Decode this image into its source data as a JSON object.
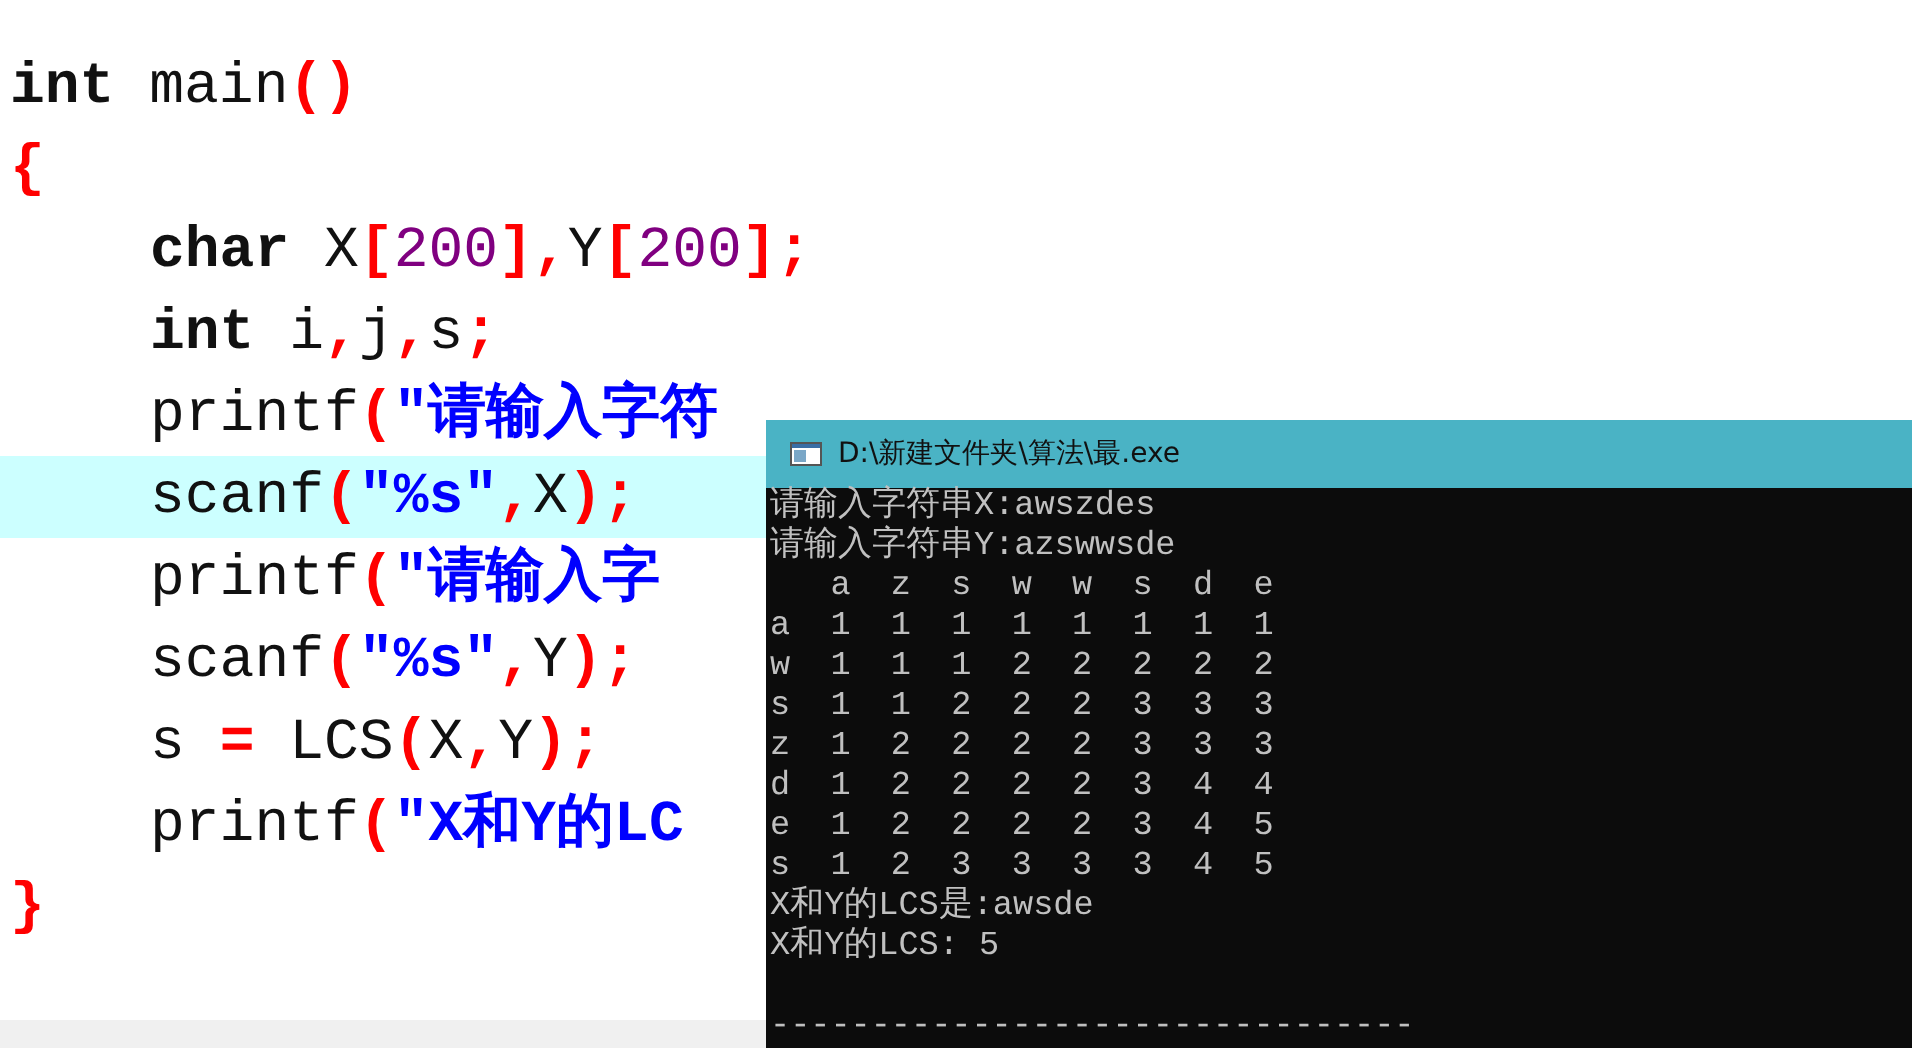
{
  "editor": {
    "lines": [
      {
        "highlighted": false,
        "tokens": [
          {
            "kind": "keyword",
            "text": "int"
          },
          {
            "kind": "plain",
            "text": " main"
          },
          {
            "kind": "punct",
            "text": "()"
          }
        ]
      },
      {
        "highlighted": false,
        "tokens": [
          {
            "kind": "punct",
            "text": "{"
          }
        ],
        "children": [
          {
            "highlighted": false,
            "tokens": [
              {
                "kind": "keyword",
                "text": "char"
              },
              {
                "kind": "plain",
                "text": " X"
              },
              {
                "kind": "punct",
                "text": "["
              },
              {
                "kind": "number",
                "text": "200"
              },
              {
                "kind": "punct",
                "text": "],"
              },
              {
                "kind": "plain",
                "text": "Y"
              },
              {
                "kind": "punct",
                "text": "["
              },
              {
                "kind": "number",
                "text": "200"
              },
              {
                "kind": "punct",
                "text": "];"
              }
            ]
          },
          {
            "highlighted": false,
            "tokens": [
              {
                "kind": "keyword",
                "text": "int"
              },
              {
                "kind": "plain",
                "text": " i"
              },
              {
                "kind": "punct",
                "text": ","
              },
              {
                "kind": "plain",
                "text": "j"
              },
              {
                "kind": "punct",
                "text": ","
              },
              {
                "kind": "plain",
                "text": "s"
              },
              {
                "kind": "punct",
                "text": ";"
              }
            ]
          },
          {
            "highlighted": false,
            "tokens": [
              {
                "kind": "plain",
                "text": "printf"
              },
              {
                "kind": "punct",
                "text": "("
              },
              {
                "kind": "string",
                "text": "\"请输入字符"
              }
            ]
          },
          {
            "highlighted": true,
            "tokens": [
              {
                "kind": "plain",
                "text": "scanf"
              },
              {
                "kind": "punct",
                "text": "("
              },
              {
                "kind": "string",
                "text": "\"%s\""
              },
              {
                "kind": "punct",
                "text": ","
              },
              {
                "kind": "plain",
                "text": "X"
              },
              {
                "kind": "punct",
                "text": ");"
              }
            ]
          },
          {
            "highlighted": false,
            "tokens": [
              {
                "kind": "plain",
                "text": "printf"
              },
              {
                "kind": "punct",
                "text": "("
              },
              {
                "kind": "string",
                "text": "\"请输入字"
              }
            ]
          },
          {
            "highlighted": false,
            "tokens": [
              {
                "kind": "plain",
                "text": "scanf"
              },
              {
                "kind": "punct",
                "text": "("
              },
              {
                "kind": "string",
                "text": "\"%s\""
              },
              {
                "kind": "punct",
                "text": ","
              },
              {
                "kind": "plain",
                "text": "Y"
              },
              {
                "kind": "punct",
                "text": ");"
              }
            ]
          },
          {
            "highlighted": false,
            "tokens": [
              {
                "kind": "plain",
                "text": "s "
              },
              {
                "kind": "punct",
                "text": "="
              },
              {
                "kind": "plain",
                "text": " LCS"
              },
              {
                "kind": "punct",
                "text": "("
              },
              {
                "kind": "plain",
                "text": "X"
              },
              {
                "kind": "punct",
                "text": ","
              },
              {
                "kind": "plain",
                "text": "Y"
              },
              {
                "kind": "punct",
                "text": ");"
              }
            ]
          },
          {
            "highlighted": false,
            "tokens": [
              {
                "kind": "plain",
                "text": "printf"
              },
              {
                "kind": "punct",
                "text": "("
              },
              {
                "kind": "string",
                "text": "\"X和Y的LC"
              }
            ]
          }
        ]
      },
      {
        "highlighted": false,
        "tokens": [
          {
            "kind": "punct",
            "text": "}"
          }
        ]
      }
    ]
  },
  "console": {
    "title": "D:\\新建文件夹\\算法\\最.exe",
    "lines": [
      {
        "kind": "output",
        "text": "请输入字符串X:awszdes"
      },
      {
        "kind": "output",
        "text": "请输入字符串Y:azswwsde"
      },
      {
        "kind": "output",
        "text": "   a  z  s  w  w  s  d  e"
      },
      {
        "kind": "output",
        "text": "a  1  1  1  1  1  1  1  1"
      },
      {
        "kind": "output",
        "text": "w  1  1  1  2  2  2  2  2"
      },
      {
        "kind": "output",
        "text": "s  1  1  2  2  2  3  3  3"
      },
      {
        "kind": "output",
        "text": "z  1  2  2  2  2  3  3  3"
      },
      {
        "kind": "output",
        "text": "d  1  2  2  2  2  3  4  4"
      },
      {
        "kind": "output",
        "text": "e  1  2  2  2  2  3  4  5"
      },
      {
        "kind": "output",
        "text": "s  1  2  3  3  3  3  4  5"
      },
      {
        "kind": "output",
        "text": "X和Y的LCS是:awsde"
      },
      {
        "kind": "output",
        "text": "X和Y的LCS: 5"
      },
      {
        "kind": "separator",
        "text": "--------------------------------"
      }
    ]
  }
}
